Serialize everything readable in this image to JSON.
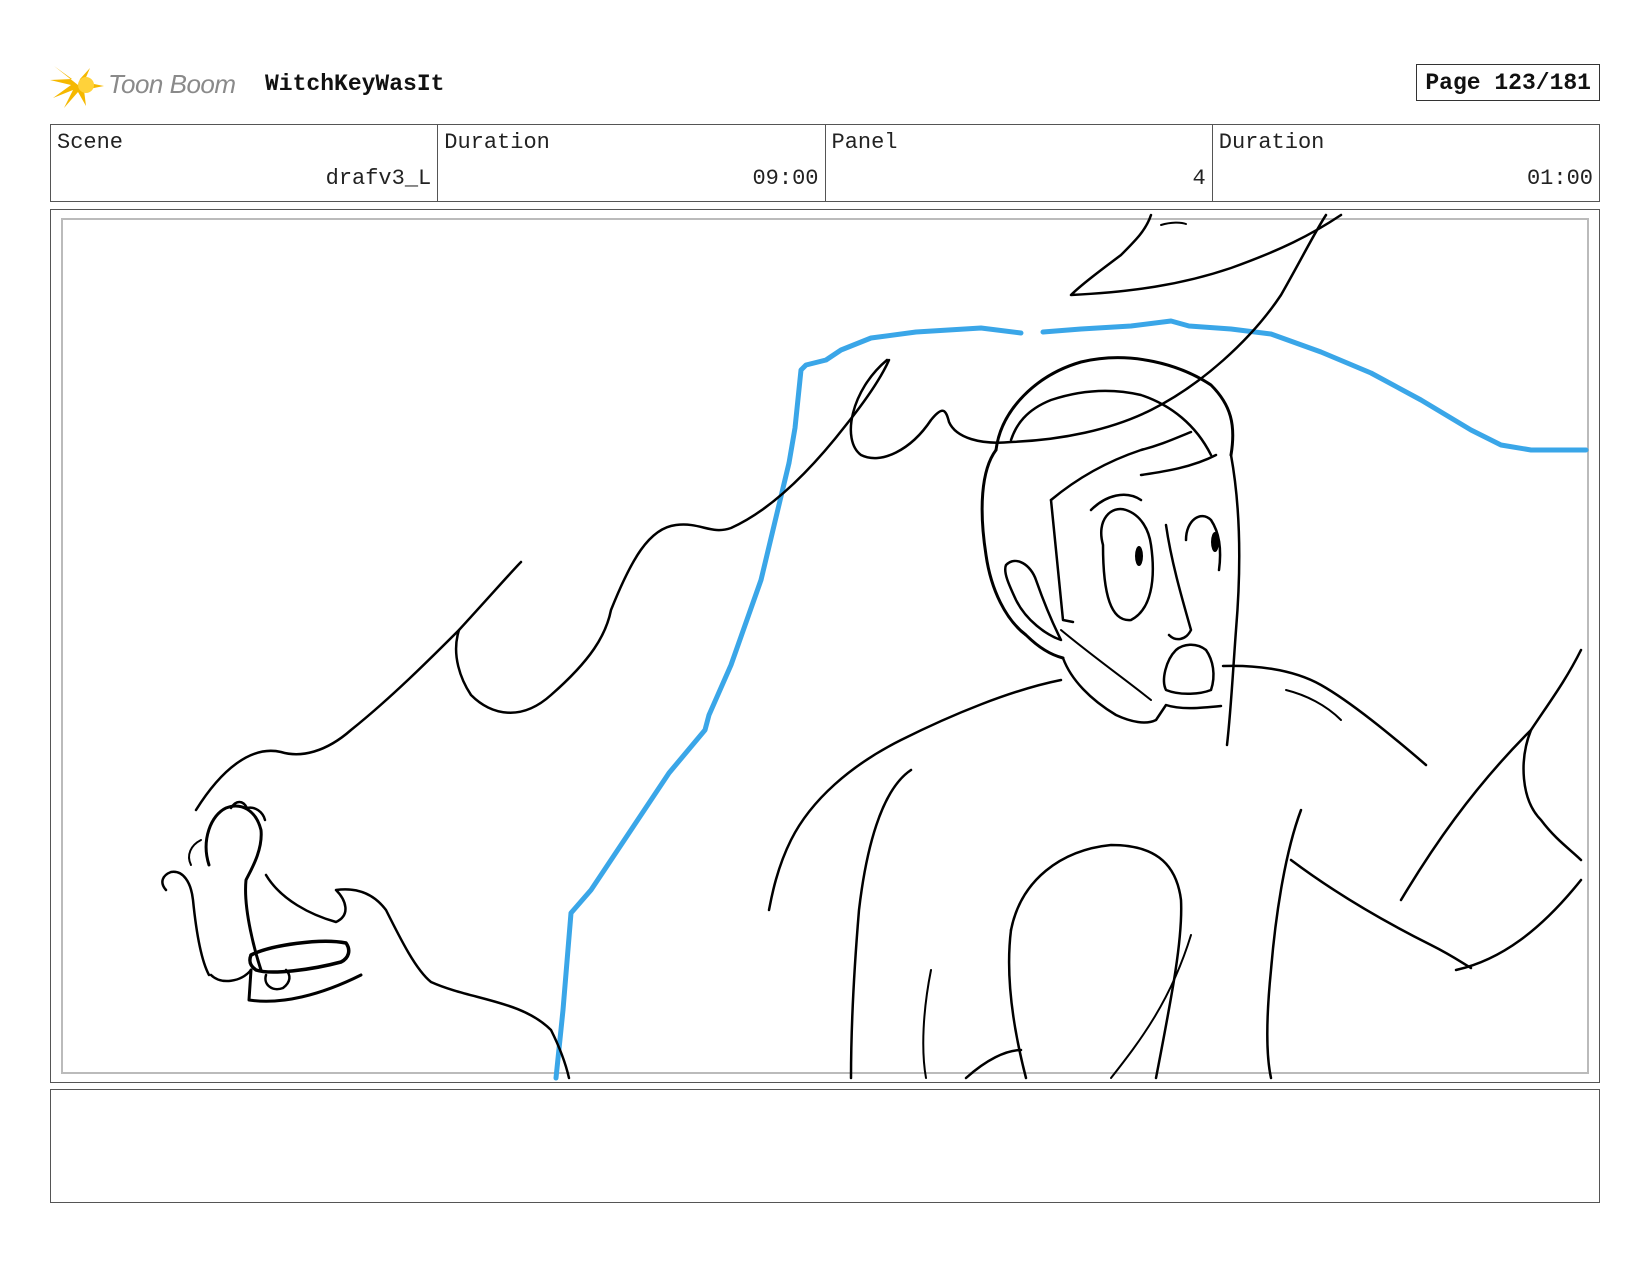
{
  "header": {
    "logo_text": "Toon Boom",
    "project_title": "WitchKeyWasIt",
    "page_label": "Page 123/181"
  },
  "info": {
    "scene_label": "Scene",
    "scene_value": "drafv3_L",
    "scene_duration_label": "Duration",
    "scene_duration_value": "09:00",
    "panel_label": "Panel",
    "panel_value": "4",
    "panel_duration_label": "Duration",
    "panel_duration_value": "01:00"
  },
  "colors": {
    "sketch_line": "#000000",
    "guide_line": "#3aa6e8",
    "logo_star": "#f5b800"
  },
  "icons": {
    "logo": "toon-boom-star-icon"
  },
  "notes": {
    "action_text": ""
  }
}
